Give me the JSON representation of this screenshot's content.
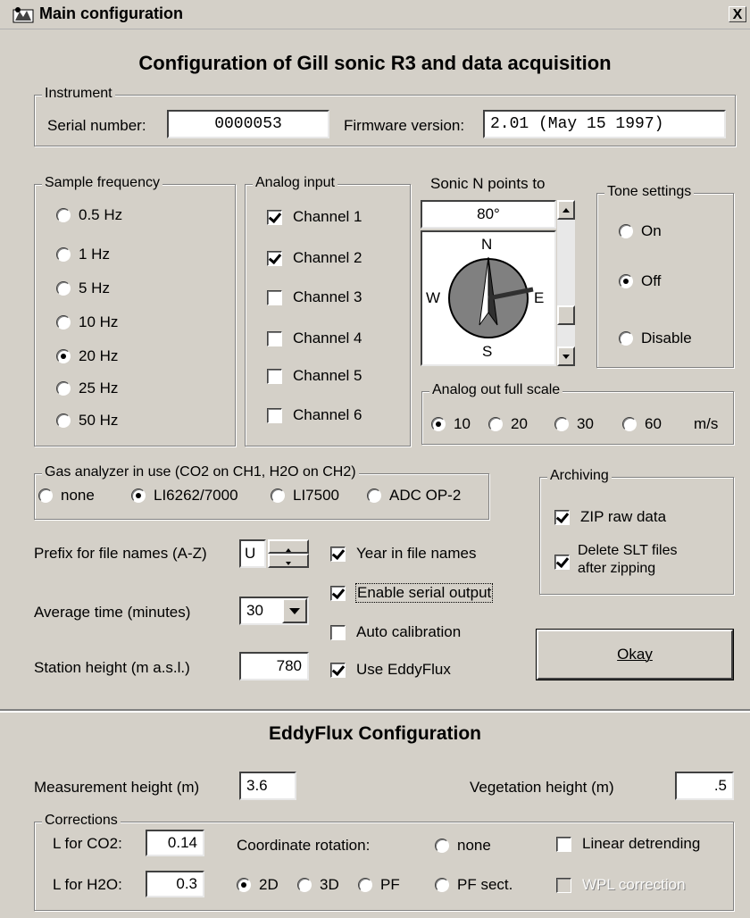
{
  "window": {
    "title": "Main configuration",
    "close_label": "X"
  },
  "main_heading": "Configuration of Gill sonic R3 and data acquisition",
  "instrument": {
    "legend": "Instrument",
    "serial_label": "Serial number:",
    "serial_value": "0000053",
    "firmware_label": "Firmware version:",
    "firmware_value": "2.01 (May 15 1997)"
  },
  "sample_frequency": {
    "legend": "Sample frequency",
    "options": [
      "0.5 Hz",
      "1 Hz",
      "5 Hz",
      "10 Hz",
      "20 Hz",
      "25 Hz",
      "50 Hz"
    ],
    "selected": "20 Hz"
  },
  "analog_input": {
    "legend": "Analog input",
    "channels": [
      {
        "label": "Channel 1",
        "checked": true
      },
      {
        "label": "Channel 2",
        "checked": true
      },
      {
        "label": "Channel 3",
        "checked": false
      },
      {
        "label": "Channel 4",
        "checked": false
      },
      {
        "label": "Channel 5",
        "checked": false
      },
      {
        "label": "Channel 6",
        "checked": false
      }
    ]
  },
  "sonic_north": {
    "label": "Sonic N points to",
    "value": "80°",
    "compass": {
      "n": "N",
      "e": "E",
      "s": "S",
      "w": "W"
    }
  },
  "tone_settings": {
    "legend": "Tone settings",
    "options": [
      "On",
      "Off",
      "Disable"
    ],
    "selected": "Off"
  },
  "analog_out": {
    "legend": "Analog out full scale",
    "options": [
      "10",
      "20",
      "30",
      "60"
    ],
    "selected": "10",
    "unit": "m/s"
  },
  "gas_analyzer": {
    "legend": "Gas analyzer in use (CO2 on CH1, H2O on CH2)",
    "options": [
      "none",
      "LI6262/7000",
      "LI7500",
      "ADC OP-2"
    ],
    "selected": "LI6262/7000"
  },
  "archiving": {
    "legend": "Archiving",
    "zip_label": "ZIP raw data",
    "zip_checked": true,
    "delete_label_1": "Delete SLT files",
    "delete_label_2": "after zipping",
    "delete_checked": true
  },
  "settings": {
    "prefix_label": "Prefix for file names (A-Z)",
    "prefix_value": "U",
    "average_label": "Average time (minutes)",
    "average_value": "30",
    "station_label": "Station height (m a.s.l.)",
    "station_value": "780",
    "year_label": "Year in file names",
    "year_checked": true,
    "serial_out_label": "Enable serial output",
    "serial_out_checked": true,
    "auto_cal_label": "Auto calibration",
    "auto_cal_checked": false,
    "eddyflux_label": "Use EddyFlux",
    "eddyflux_checked": true
  },
  "okay_button": {
    "label": "Okay"
  },
  "eddyflux": {
    "heading": "EddyFlux Configuration",
    "meas_label": "Measurement height (m)",
    "meas_value": "3.6",
    "veg_label": "Vegetation height (m)",
    "veg_value": ".5",
    "corrections": {
      "legend": "Corrections",
      "lco2_label": "L for CO2:",
      "lco2_value": "0.14",
      "lh2o_label": "L for H2O:",
      "lh2o_value": "0.3",
      "coord_label": "Coordinate rotation:",
      "coord_options": [
        "none",
        "2D",
        "3D",
        "PF",
        "PF sect."
      ],
      "coord_selected": "2D",
      "linear_label": "Linear detrending",
      "linear_checked": false,
      "wpl_label": "WPL correction",
      "wpl_checked": false
    }
  },
  "colors": {
    "face": "#d4d0c8",
    "shadow": "#808080",
    "needle": "#303030"
  }
}
